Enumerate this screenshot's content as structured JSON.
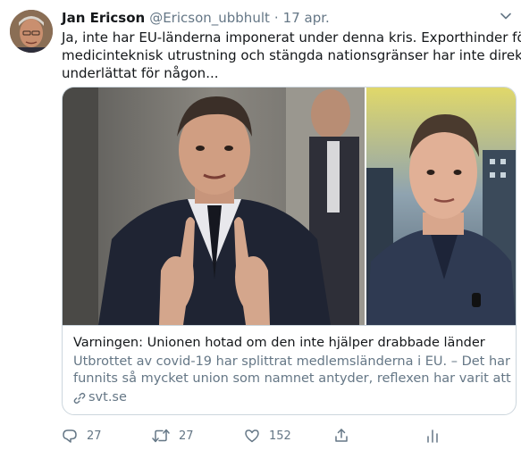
{
  "author": {
    "display_name": "Jan Ericson",
    "handle": "@Ericson_ubbhult",
    "separator": "·",
    "date": "17 apr."
  },
  "tweet": {
    "lines": [
      "Ja, inte har EU-länderna imponerat under denna kris. Exporthinder för",
      "medicinteknisk utrustning  och stängda nationsgränser har inte direkt",
      "underlättat för någon..."
    ]
  },
  "card": {
    "title": "Varningen: Unionen hotad om den inte hjälper drabbade länder",
    "description_lines": [
      "Utbrottet av covid-19 har splittrat medlemsländerna i EU. – Det har inte",
      "funnits så mycket union som namnet antyder, reflexen har varit att ager..."
    ],
    "domain": "svt.se"
  },
  "actions": {
    "reply_count": "27",
    "retweet_count": "27",
    "like_count": "152"
  },
  "icons": {
    "more": "chevron-down-icon",
    "reply": "reply-icon",
    "retweet": "retweet-icon",
    "like": "heart-icon",
    "share": "share-icon",
    "analytics": "analytics-icon",
    "link": "link-icon"
  },
  "colors": {
    "text": "#14171a",
    "secondary": "#657786",
    "border": "#ccd6dd"
  }
}
